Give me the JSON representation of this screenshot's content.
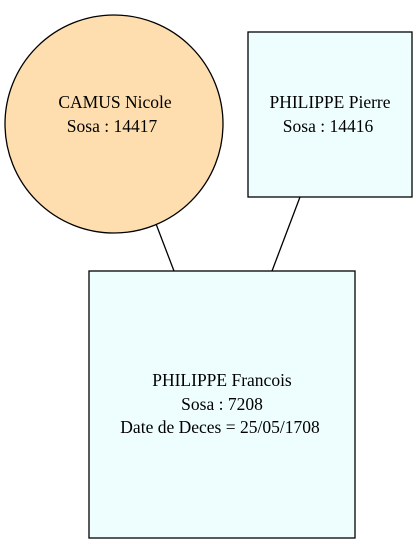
{
  "colors": {
    "female_fill": "#fedeae",
    "male_fill": "#eefefe",
    "stroke": "#000000",
    "background": "#ffffff"
  },
  "nodes": {
    "mother": {
      "shape": "ellipse",
      "lines": [
        "CAMUS Nicole",
        "Sosa : 14417"
      ]
    },
    "father": {
      "shape": "box",
      "lines": [
        "PHILIPPE Pierre",
        "Sosa : 14416"
      ]
    },
    "child": {
      "shape": "box",
      "lines": [
        "PHILIPPE Francois",
        "Sosa : 7208",
        "Date de Deces = 25/05/1708"
      ]
    }
  },
  "edges": [
    {
      "from": "mother",
      "to": "child"
    },
    {
      "from": "father",
      "to": "child"
    }
  ]
}
